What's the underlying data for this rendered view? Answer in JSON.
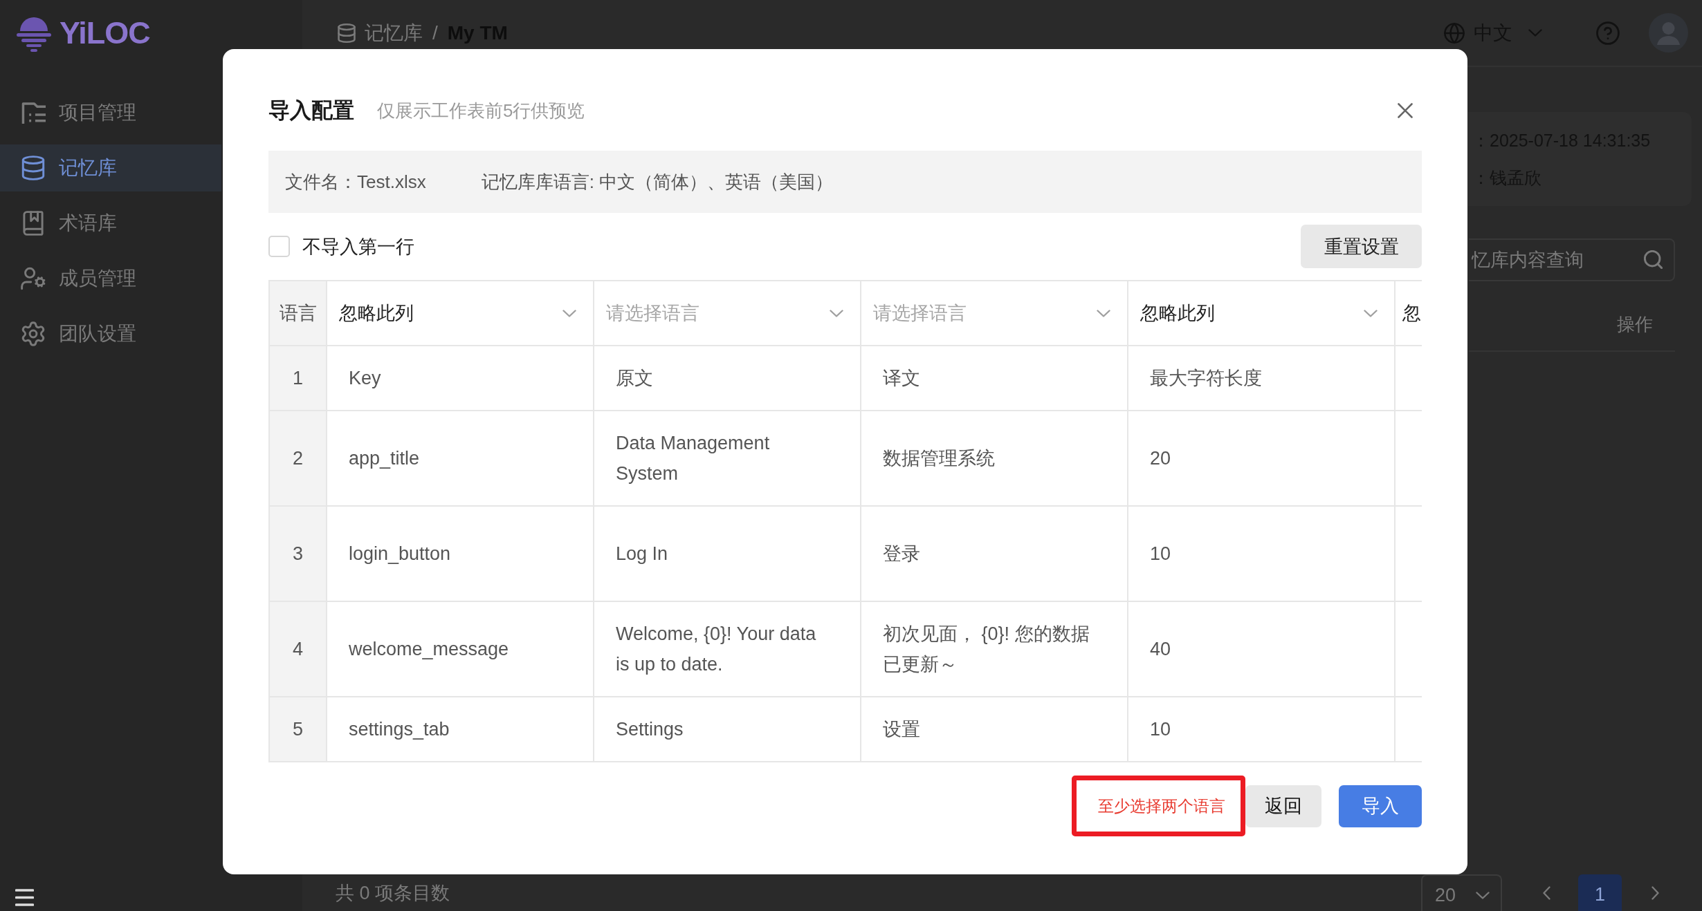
{
  "sidebar": {
    "brand": "YiLOC",
    "items": [
      {
        "label": "项目管理",
        "selected": false
      },
      {
        "label": "记忆库",
        "selected": true
      },
      {
        "label": "术语库",
        "selected": false
      },
      {
        "label": "成员管理",
        "selected": false
      },
      {
        "label": "团队设置",
        "selected": false
      }
    ]
  },
  "header": {
    "breadcrumb": [
      "记忆库",
      "My TM"
    ],
    "separator": "/",
    "language": "中文"
  },
  "detail": {
    "lines": [
      "：2025-07-18 14:31:35",
      "：钱孟欣"
    ],
    "search": {
      "placeholder": "忆库内容查询"
    },
    "column_header": "操作"
  },
  "pagination": {
    "total": "共 0 项条目数",
    "page_size": "20",
    "pages": [
      {
        "label": "1",
        "selected": true
      }
    ]
  },
  "dialog": {
    "title": "导入配置",
    "hint": "仅展示工作表前5行供预览",
    "info": {
      "file": "文件名：Test.xlsx",
      "languages": "记忆库库语言: 中文（简体）、英语（美国）"
    },
    "skip_first_row": {
      "label": "不导入第一行",
      "checked": false
    },
    "reset_button": "重置设置",
    "table": {
      "columns": [
        {
          "kind": "label",
          "label": "语言"
        },
        {
          "kind": "select",
          "value": "忽略此列"
        },
        {
          "kind": "select",
          "placeholder": "请选择语言"
        },
        {
          "kind": "select",
          "placeholder": "请选择语言"
        },
        {
          "kind": "select",
          "value": "忽略此列"
        },
        {
          "kind": "clipped",
          "value": "忽"
        }
      ],
      "rows": [
        {
          "cells": [
            "1",
            "Key",
            "原文",
            "译文",
            "最大字符长度"
          ]
        },
        {
          "cells": [
            "2",
            "app_title",
            "Data Management System",
            "数据管理系统",
            "20"
          ]
        },
        {
          "cells": [
            "3",
            "login_button",
            "Log In",
            "登录",
            "10"
          ]
        },
        {
          "cells": [
            "4",
            "welcome_message",
            "Welcome, {0}! Your data is up to date.",
            "初次见面， {0}! 您的数据已更新～",
            "40"
          ]
        },
        {
          "cells": [
            "5",
            "settings_tab",
            "Settings",
            "设置",
            "10"
          ]
        }
      ]
    },
    "error": {
      "text": "至少选择两个语言",
      "highlighted": true
    },
    "buttons": [
      {
        "label": "返回",
        "kind": "secondary"
      },
      {
        "label": "导入",
        "kind": "primary"
      }
    ]
  }
}
